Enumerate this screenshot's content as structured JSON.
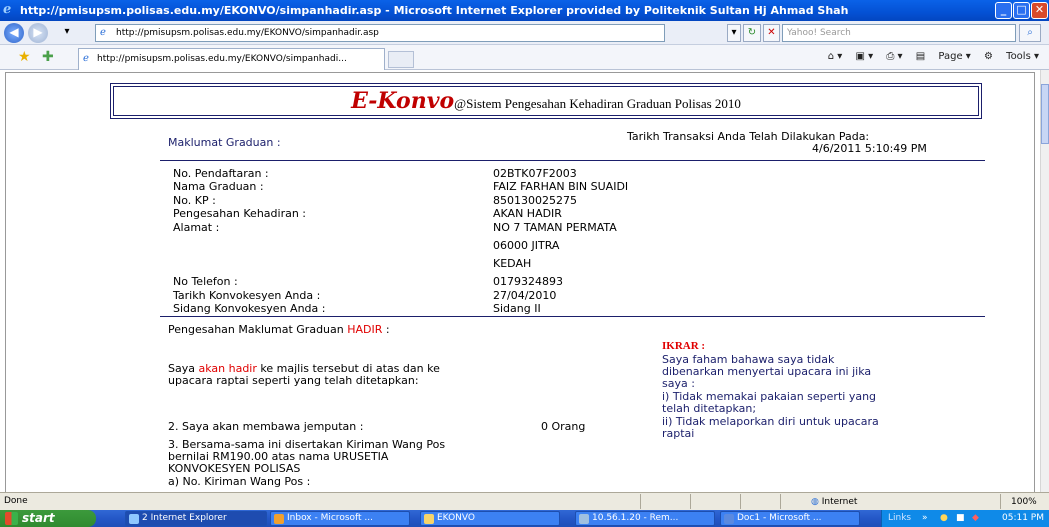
{
  "window": {
    "title": "http://pmisupsm.polisas.edu.my/EKONVO/simpanhadir.asp - Microsoft Internet Explorer provided by Politeknik Sultan Hj Ahmad Shah"
  },
  "addressbar": {
    "url": "http://pmisupsm.polisas.edu.my/EKONVO/simpanhadir.asp",
    "search_placeholder": "Yahoo! Search"
  },
  "tab": {
    "label": "http://pmisupsm.polisas.edu.my/EKONVO/simpanhadi..."
  },
  "toolbar": {
    "page_label": "Page",
    "tools_label": "Tools"
  },
  "page": {
    "logo": "E-Konvo",
    "subtitle": "@Sistem Pengesahan Kehadiran Graduan Polisas 2010",
    "maklumat_label": "Maklumat Graduan :",
    "transaksi_label": "Tarikh Transaksi Anda Telah Dilakukan Pada:",
    "transaksi_value": "4/6/2011 5:10:49 PM",
    "fields": [
      {
        "label": "No. Pendaftaran :",
        "value": "02BTK07F2003"
      },
      {
        "label": "Nama Graduan :",
        "value": "FAIZ FARHAN BIN SUAIDI"
      },
      {
        "label": "No. KP :",
        "value": "850130025275"
      },
      {
        "label": "Pengesahan Kehadiran :",
        "value": "AKAN HADIR"
      },
      {
        "label": "Alamat :",
        "value": "NO 7 TAMAN PERMATA"
      }
    ],
    "alamat_lines": [
      "06000 JITRA",
      "KEDAH"
    ],
    "fields2": [
      {
        "label": "No Telefon :",
        "value": "0179324893"
      },
      {
        "label": "Tarikh Konvokesyen Anda :",
        "value": "27/04/2010"
      },
      {
        "label": "Sidang Konvokesyen Anda :",
        "value": "Sidang II"
      }
    ],
    "pengesahan_label": "Pengesahan Maklumat Graduan",
    "pengesahan_status": "HADIR",
    "pengesahan_colon": ":",
    "saya_1": "Saya",
    "saya_2": "akan hadir",
    "saya_3": "ke majlis tersebut di atas dan ke",
    "saya_line2": "upacara raptai seperti yang telah ditetapkan:",
    "jemputan_label": "2. Saya akan membawa jemputan :",
    "jemputan_value": "0 Orang",
    "kiriman_line1": "3. Bersama-sama ini disertakan Kiriman Wang Pos",
    "kiriman_line2": "bernilai RM190.00 atas nama URUSETIA",
    "kiriman_line3": "KONVOKESYEN POLISAS",
    "kiriman_no": "a) No. Kiriman Wang Pos :",
    "ikrar_title": "IKRAR :",
    "ikrar_lines": [
      "Saya faham bahawa saya tidak",
      "dibenarkan menyertai upacara ini jika",
      "saya :",
      "i) Tidak memakai pakaian seperti yang",
      "telah ditetapkan;",
      "ii) Tidak melaporkan diri untuk upacara",
      "raptai"
    ]
  },
  "statusbar": {
    "status": "Done",
    "zone": "Internet",
    "zoom": "100%"
  },
  "taskbar": {
    "start": "start",
    "tasks": [
      "2 Internet Explorer",
      "Inbox - Microsoft ...",
      "EKONVO",
      "10.56.1.20 - Rem...",
      "Doc1 - Microsoft ..."
    ],
    "links": "Links",
    "clock": "05:11 PM"
  }
}
